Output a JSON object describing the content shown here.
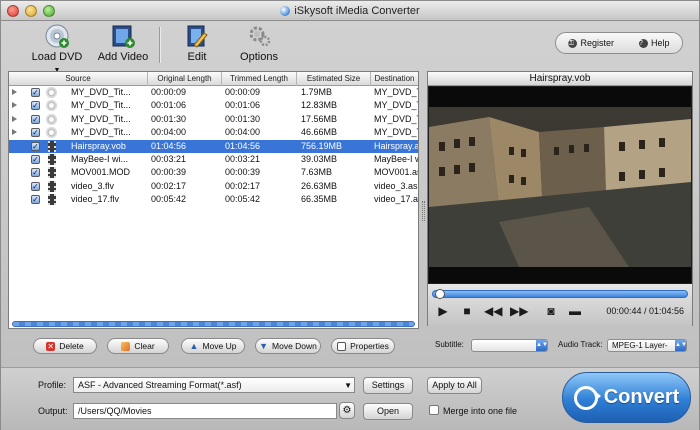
{
  "window": {
    "title": "iSkysoft iMedia Converter"
  },
  "toolbar": {
    "load_dvd": "Load DVD",
    "add_video": "Add Video",
    "edit": "Edit",
    "options": "Options",
    "register": "Register",
    "help": "Help"
  },
  "table": {
    "headers": [
      "Source",
      "Original Length",
      "Trimmed Length",
      "Estimated Size",
      "Destination"
    ],
    "rows": [
      {
        "source": "MY_DVD_Tit...",
        "orig": "00:00:09",
        "trim": "00:00:09",
        "size": "1.79MB",
        "dest": "MY_DVD_Tit",
        "kind": "dvd"
      },
      {
        "source": "MY_DVD_Tit...",
        "orig": "00:01:06",
        "trim": "00:01:06",
        "size": "12.83MB",
        "dest": "MY_DVD_Tit",
        "kind": "dvd"
      },
      {
        "source": "MY_DVD_Tit...",
        "orig": "00:01:30",
        "trim": "00:01:30",
        "size": "17.56MB",
        "dest": "MY_DVD_Tit",
        "kind": "dvd"
      },
      {
        "source": "MY_DVD_Tit...",
        "orig": "00:04:00",
        "trim": "00:04:00",
        "size": "46.66MB",
        "dest": "MY_DVD_Tit",
        "kind": "dvd"
      },
      {
        "source": "Hairspray.vob",
        "orig": "01:04:56",
        "trim": "01:04:56",
        "size": "756.19MB",
        "dest": "Hairspray.a",
        "kind": "video",
        "selected": true
      },
      {
        "source": "MayBee-I wi...",
        "orig": "00:03:21",
        "trim": "00:03:21",
        "size": "39.03MB",
        "dest": "MayBee-I wi",
        "kind": "video"
      },
      {
        "source": "MOV001.MOD",
        "orig": "00:00:39",
        "trim": "00:00:39",
        "size": "7.63MB",
        "dest": "MOV001.as",
        "kind": "video"
      },
      {
        "source": "video_3.flv",
        "orig": "00:02:17",
        "trim": "00:02:17",
        "size": "26.63MB",
        "dest": "video_3.as",
        "kind": "video"
      },
      {
        "source": "video_17.flv",
        "orig": "00:05:42",
        "trim": "00:05:42",
        "size": "66.35MB",
        "dest": "video_17.a",
        "kind": "video"
      }
    ]
  },
  "list_buttons": {
    "delete": "Delete",
    "clear": "Clear",
    "move_up": "Move Up",
    "move_down": "Move Down",
    "properties": "Properties"
  },
  "player": {
    "title": "Hairspray.vob",
    "time": "00:00:44 / 01:04:56",
    "seek_fraction": 0.011,
    "subtitle_label": "Subtitle:",
    "subtitle_value": "",
    "audio_label": "Audio Track:",
    "audio_value": "MPEG-1 Layer-"
  },
  "bottom": {
    "profile_label": "Profile:",
    "profile_value": "ASF - Advanced Streaming Format(*.asf)",
    "output_label": "Output:",
    "output_value": "/Users/QQ/Movies",
    "settings": "Settings",
    "apply_all": "Apply to All",
    "open": "Open",
    "merge": "Merge into one file",
    "convert": "Convert"
  }
}
